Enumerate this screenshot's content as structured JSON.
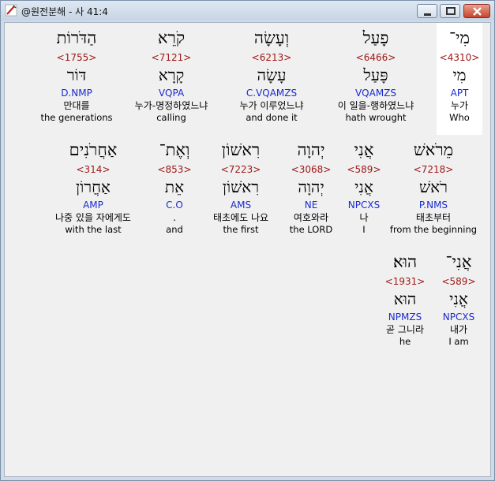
{
  "window": {
    "title": "@원전분해 - 사 41:4"
  },
  "rows": [
    [
      {
        "heb": "מִי־",
        "strong": "<4310>",
        "lex": "מִי",
        "code": "APT",
        "kor": "누가",
        "eng": "Who",
        "highlight": true
      },
      {
        "heb": "פָעַל",
        "strong": "<6466>",
        "lex": "פָּעַל",
        "code": "VQAMZS",
        "kor": "이 일을-행하였느냐",
        "eng": "hath wrought",
        "highlight": false
      },
      {
        "heb": "וְעָשָׂה",
        "strong": "<6213>",
        "lex": "עָשָׂה",
        "code": "C.VQAMZS",
        "kor": "누가 이루었느냐",
        "eng": "and done it",
        "highlight": false
      },
      {
        "heb": "קֹרֵא",
        "strong": "<7121>",
        "lex": "קָרָא",
        "code": "VQPA",
        "kor": "누가-명정하였느냐",
        "eng": "calling",
        "highlight": false
      },
      {
        "heb": "הַדֹּרוֹת",
        "strong": "<1755>",
        "lex": "דּוֹר",
        "code": "D.NMP",
        "kor": "만대를",
        "eng": "the generations",
        "highlight": false
      }
    ],
    [
      {
        "heb": "מֵרֹאשׁ",
        "strong": "<7218>",
        "lex": "רֹאשׁ",
        "code": "P.NMS",
        "kor": "태초부터",
        "eng": "from the beginning",
        "highlight": false
      },
      {
        "heb": "אֲנִי",
        "strong": "<589>",
        "lex": "אֲנִי",
        "code": "NPCXS",
        "kor": "나",
        "eng": "I",
        "highlight": false
      },
      {
        "heb": "יְהוָה",
        "strong": "<3068>",
        "lex": "יְהוָה",
        "code": "NE",
        "kor": "여호와라",
        "eng": "the LORD",
        "highlight": false
      },
      {
        "heb": "רִאשׁוֹן",
        "strong": "<7223>",
        "lex": "רִאשׁוֹן",
        "code": "AMS",
        "kor": "태초에도 나요",
        "eng": "the first",
        "highlight": false
      },
      {
        "heb": "וְאֶת־",
        "strong": "<853>",
        "lex": "אֵת",
        "code": "C.O",
        "kor": ".",
        "eng": "and",
        "highlight": false
      },
      {
        "heb": "אַחֲרֹנִים",
        "strong": "<314>",
        "lex": "אַחֲרוֹן",
        "code": "AMP",
        "kor": "나중 있을 자에게도",
        "eng": "with the last",
        "highlight": false
      }
    ],
    [
      {
        "heb": "אֲנִי־",
        "strong": "<589>",
        "lex": "אֲנִי",
        "code": "NPCXS",
        "kor": "내가",
        "eng": "I am",
        "highlight": false
      },
      {
        "heb": "הוּא׃",
        "strong": "<1931>",
        "lex": "הוּא",
        "code": "NPMZS",
        "kor": "곧 그니라",
        "eng": "he",
        "highlight": false
      }
    ]
  ]
}
